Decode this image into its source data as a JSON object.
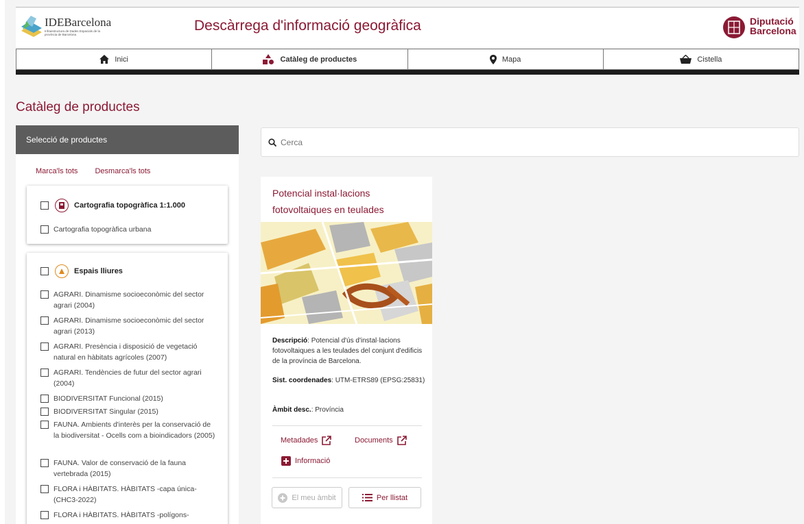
{
  "header": {
    "logo_brand": "IDEBarcelona",
    "logo_subtitle": "Infraestructura de Dades Espacials de la província de Barcelona",
    "site_title": "Descàrrega d'informació geogràfica",
    "org_line1": "Diputació",
    "org_line2": "Barcelona"
  },
  "nav": {
    "items": [
      {
        "label": "Inici",
        "icon": "home-icon"
      },
      {
        "label": "Catàleg de productes",
        "icon": "shapes-icon",
        "active": true
      },
      {
        "label": "Mapa",
        "icon": "map-marker-icon"
      },
      {
        "label": "Cistella",
        "icon": "basket-icon"
      }
    ]
  },
  "page_title": "Catàleg de productes",
  "sidebar": {
    "header": "Selecció de productes",
    "mark_all": "Marca'ls tots",
    "unmark_all": "Desmarca'ls tots",
    "groups": [
      {
        "title": "Cartografia topogràfica 1:1.000",
        "items": [
          "Cartografia topogràfica urbana"
        ]
      },
      {
        "title": "Espais lliures",
        "items": [
          "AGRARI. Dinamisme socioeconòmic del sector agrari (2004)",
          "AGRARI. Dinamisme socioeconòmic del sector agrari (2013)",
          "AGRARI. Presència i disposició de vegetació natural en hàbitats agrícoles (2007)",
          "AGRARI. Tendències de futur del sector agrari (2004)",
          "BIODIVERSITAT Funcional (2015)",
          "BIODIVERSITAT Singular (2015)",
          "FAUNA. Ambients d'interès per la conservació de la biodiversitat - Ocells com a bioindicadors (2005)",
          "FAUNA. Valor de conservació de la fauna vertebrada (2015)",
          "FLORA i HÀBITATS. HÀBITATS -capa única- (CHC3-2022)",
          "FLORA i HÀBITATS. HÀBITATS -polígons-"
        ]
      }
    ]
  },
  "search": {
    "placeholder": "Cerca"
  },
  "product": {
    "title": "Potencial instal·lacions fotovoltaiques en teulades",
    "desc_label": "Descripció",
    "desc_value": ": Potencial d'ús d'instal·lacions fotovoltaiques a les teulades del conjunt d'edificis de la província de Barcelona.",
    "crs_label": "Sist. coordenades",
    "crs_value": ": UTM-ETRS89 (EPSG:25831)",
    "scope_label": "Àmbit desc.",
    "scope_value": ": Província",
    "metadata_link": "Metadades",
    "documents_link": "Documents",
    "info_link": "Informació",
    "my_area_button": "El meu àmbit",
    "list_button": "Per llistat"
  },
  "colors": {
    "accent": "#8b1a34",
    "sidebar_header": "#5c5c5c",
    "nav_bar": "#1c1c1c"
  }
}
